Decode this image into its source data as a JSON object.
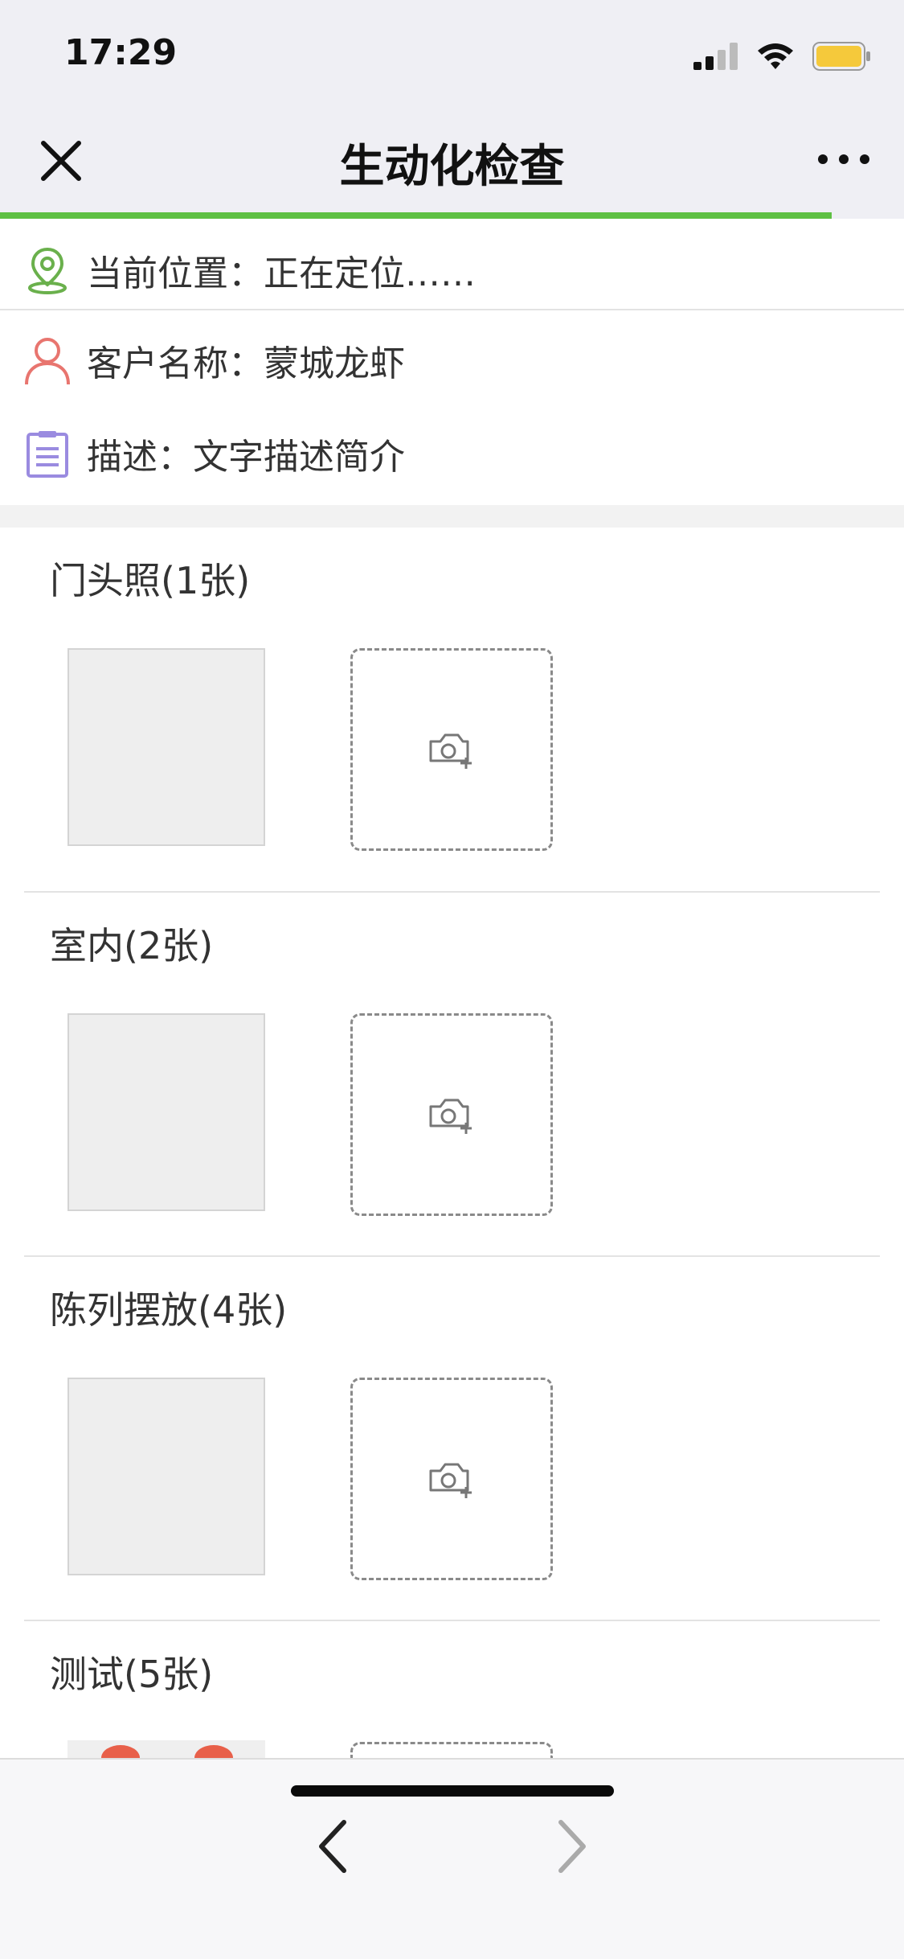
{
  "status": {
    "time": "17:29"
  },
  "nav": {
    "title": "生动化检查",
    "progress": 0.92
  },
  "info": {
    "location": "当前位置：正在定位……",
    "customer": "客户名称：蒙城龙虾",
    "description": "描述：文字描述简介"
  },
  "sections": [
    {
      "title": "门头照(1张)"
    },
    {
      "title": "室内(2张)"
    },
    {
      "title": "陈列摆放(4张)"
    },
    {
      "title": "测试(5张)"
    }
  ],
  "colors": {
    "accent": "#5ec043",
    "location_icon": "#6ab04c",
    "customer_icon": "#e8756f",
    "description_icon": "#9a8be0"
  },
  "icons": {
    "close": "close-icon",
    "more": "more-icon",
    "location": "location-pin-icon",
    "customer": "user-icon",
    "description": "clipboard-icon",
    "add_photo": "camera-add-icon",
    "back": "chevron-left-icon",
    "forward": "chevron-right-icon"
  }
}
